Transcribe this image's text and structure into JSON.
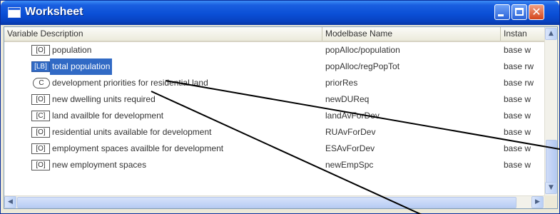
{
  "window": {
    "title": "Worksheet"
  },
  "columns": [
    "Variable Description",
    "Modelbase Name",
    "Instan"
  ],
  "rows": [
    {
      "badge": "[O]",
      "desc": "population",
      "name": "popAlloc/population",
      "instance": "base w"
    },
    {
      "badge": "[LB]",
      "desc": "total population",
      "name": "popAlloc/regPopTot",
      "instance": "base rw",
      "selected": true
    },
    {
      "badge": "C",
      "desc": "development priorities for residential land",
      "name": "priorRes",
      "instance": "base rw"
    },
    {
      "badge": "[O]",
      "desc": "new dwelling units required",
      "name": "newDUReq",
      "instance": "base w"
    },
    {
      "badge": "[C]",
      "desc": "land availble for development",
      "name": "landAvForDev",
      "instance": "base w"
    },
    {
      "badge": "[O]",
      "desc": "residential units available for development",
      "name": "RUAvForDev",
      "instance": "base w"
    },
    {
      "badge": "[O]",
      "desc": "employment spaces availble for development",
      "name": "ESAvForDev",
      "instance": "base w"
    },
    {
      "badge": "[O]",
      "desc": "new employment spaces",
      "name": "newEmpSpc",
      "instance": "base w"
    }
  ]
}
